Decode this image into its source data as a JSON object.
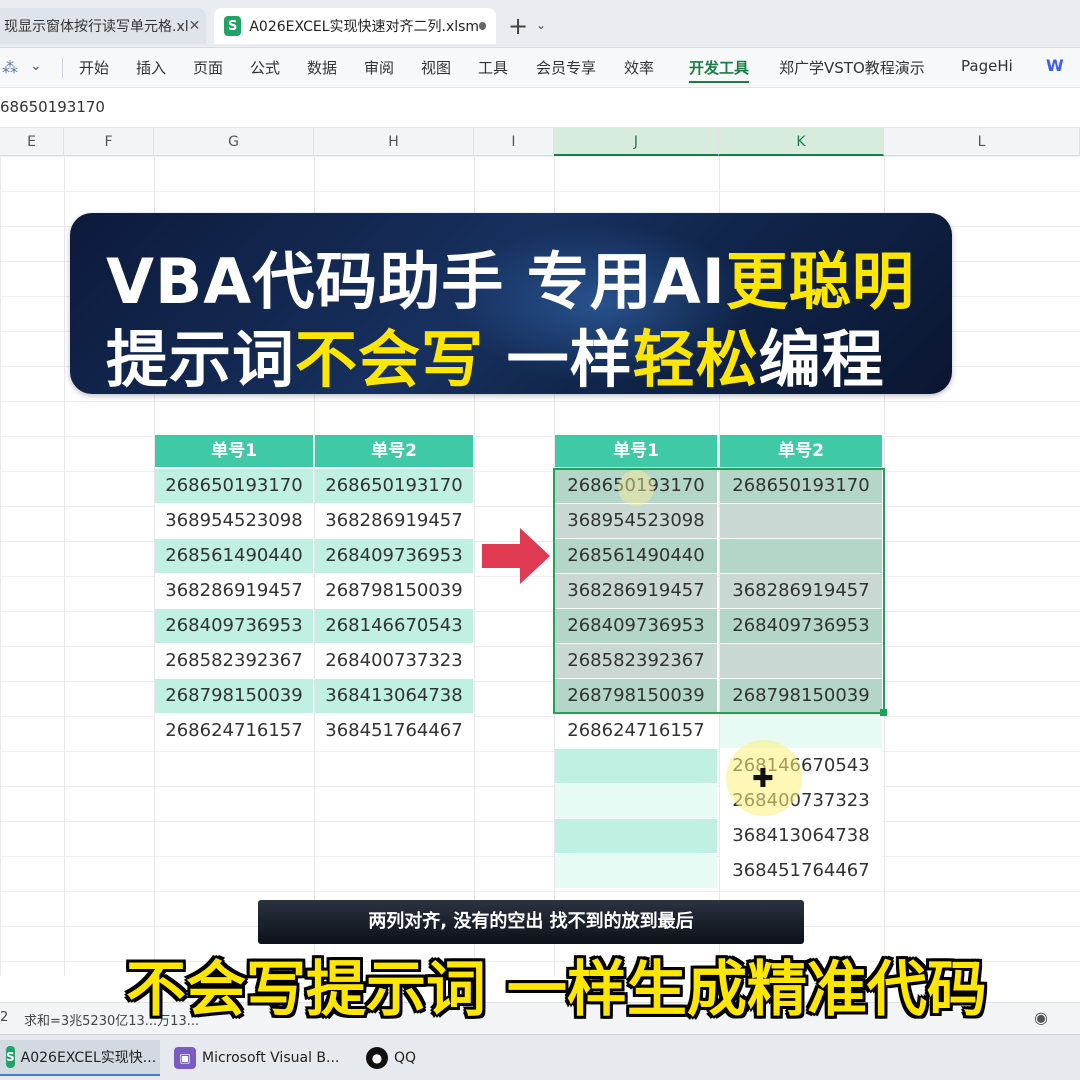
{
  "tabs": {
    "inactive_label": "现显示窗体按行读写单元格.xl",
    "inactive_close": "✕",
    "active_icon": "S",
    "active_label": "A026EXCEL实现快速对齐二列.xlsm",
    "new_tab": "+",
    "menu": "⌄"
  },
  "ribbon": {
    "items": [
      "开始",
      "插入",
      "页面",
      "公式",
      "数据",
      "审阅",
      "视图",
      "工具",
      "会员专享",
      "效率",
      "开发工具",
      "郑广学VSTO教程演示",
      "PageHi"
    ],
    "active_item": "开发工具",
    "w_label": "W"
  },
  "formula_bar": {
    "value": "68650193170"
  },
  "columns": [
    "E",
    "F",
    "G",
    "H",
    "I",
    "J",
    "K",
    "L"
  ],
  "banner": {
    "l1a": "VBA代码助手 专用AI",
    "l1b": "更聪明",
    "l2a": "提示词",
    "l2b": "不会写",
    "l2c": " 一样",
    "l2d": "轻松",
    "l2e": "编程"
  },
  "left_table": {
    "headers": [
      "单号1",
      "单号2"
    ],
    "rows": [
      [
        "268650193170",
        "268650193170"
      ],
      [
        "368954523098",
        "368286919457"
      ],
      [
        "268561490440",
        "268409736953"
      ],
      [
        "368286919457",
        "268798150039"
      ],
      [
        "268409736953",
        "268146670543"
      ],
      [
        "268582392367",
        "268400737323"
      ],
      [
        "268798150039",
        "368413064738"
      ],
      [
        "268624716157",
        "368451764467"
      ]
    ]
  },
  "right_table": {
    "headers": [
      "单号1",
      "单号2"
    ],
    "rows": [
      [
        "268650193170",
        "268650193170"
      ],
      [
        "368954523098",
        ""
      ],
      [
        "268561490440",
        ""
      ],
      [
        "368286919457",
        "368286919457"
      ],
      [
        "268409736953",
        "268409736953"
      ],
      [
        "268582392367",
        ""
      ],
      [
        "268798150039",
        "268798150039"
      ],
      [
        "268624716157",
        ""
      ],
      [
        "",
        "268146670543"
      ],
      [
        "",
        "268400737323"
      ],
      [
        "",
        "368413064738"
      ],
      [
        "",
        "368451764467"
      ]
    ]
  },
  "captions": {
    "small": "两列对齐, 没有的空出 找不到的放到最后",
    "big": "不会写提示词 一样生成精准代码"
  },
  "status": {
    "num": "2",
    "sum": "求和=3兆5230亿13...万13..."
  },
  "taskbar": {
    "items": [
      "A026EXCEL实现快...",
      "Microsoft Visual B...",
      "QQ"
    ]
  },
  "colors": {
    "accent_green": "#1e7b47",
    "header_teal": "#3fc9a5",
    "row_teal": "#bff0e1",
    "banner_yellow": "#ffe600",
    "arrow_red": "#e03a52"
  }
}
